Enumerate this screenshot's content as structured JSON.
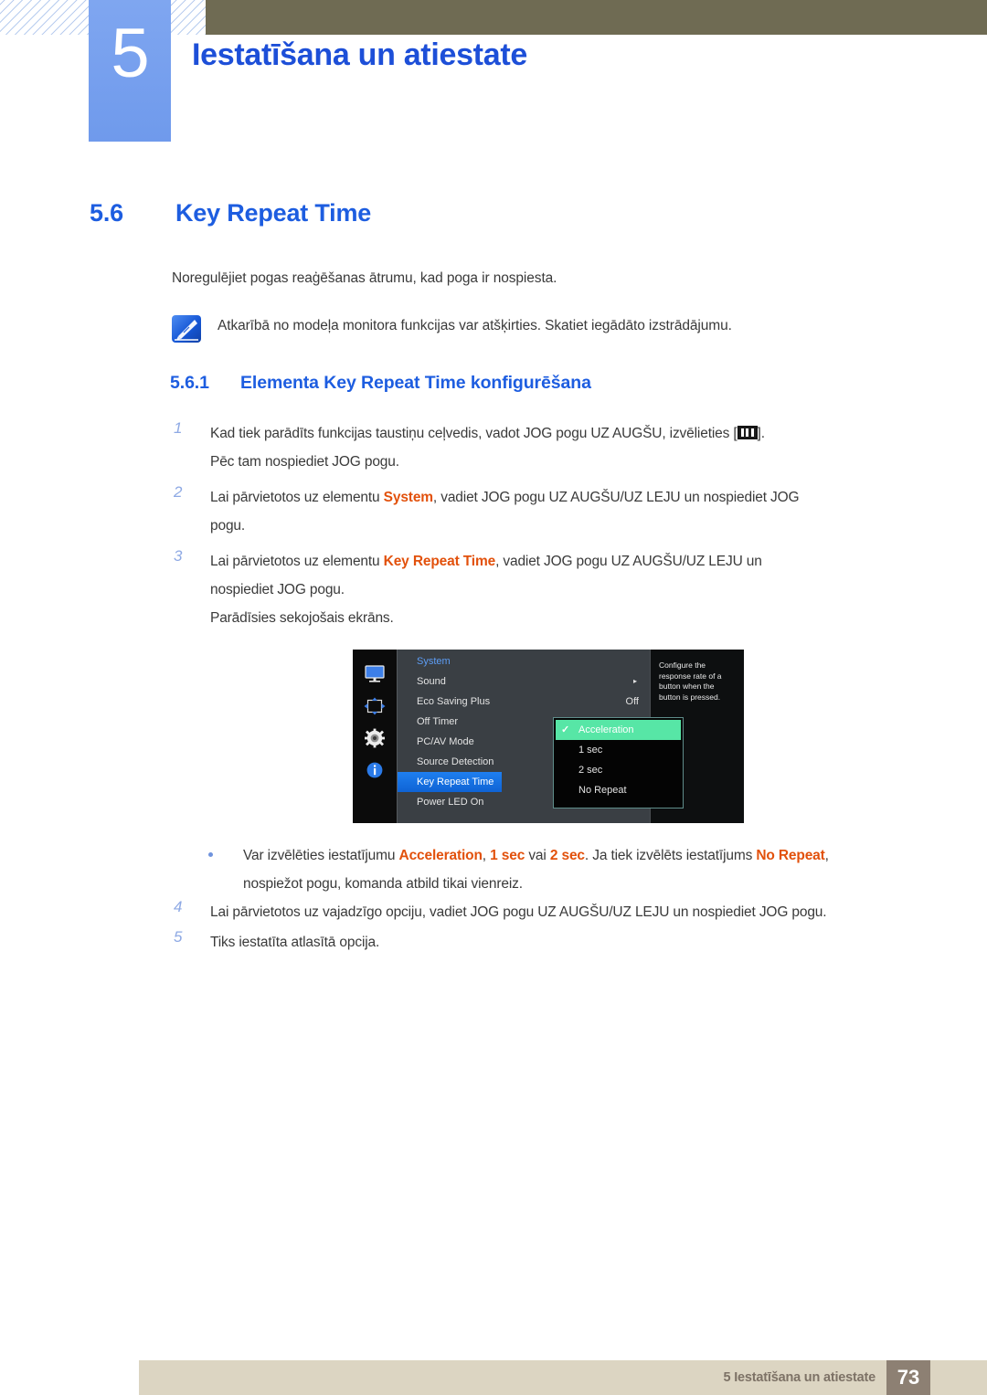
{
  "header": {
    "chapter_number": "5",
    "chapter_title": "Iestatīšana un atiestate",
    "hatch_color": "#b9cdef",
    "bar_color": "#6f6b53",
    "chapter_block_color": "#7fa6f0",
    "title_color": "#1d4fd8"
  },
  "section": {
    "number": "5.6",
    "title": "Key Repeat Time",
    "intro": "Noregulējiet pogas reaģēšanas ātrumu, kad poga ir nospiesta.",
    "color": "#1d5de0"
  },
  "note": {
    "icon": "note-pen-icon",
    "text": "Atkarībā no modeļa monitora funkcijas var atšķirties. Skatiet iegādāto izstrādājumu."
  },
  "subsection": {
    "number": "5.6.1",
    "title": "Elementa Key Repeat Time konfigurēšana"
  },
  "steps": [
    {
      "index": "1",
      "lines": [
        {
          "pre": "Kad tiek parādīts funkcijas taustiņu ceļvedis, vadot JOG pogu UZ AUGŠU, izvēlieties [",
          "icon": "menu-bars-icon",
          "post": "]."
        },
        {
          "pre": "Pēc tam nospiediet JOG pogu."
        }
      ]
    },
    {
      "index": "2",
      "lines": [
        {
          "pre": "Lai pārvietotos uz elementu ",
          "kw": "System",
          "post": ", vadiet JOG pogu UZ AUGŠU/UZ LEJU un nospiediet JOG"
        },
        {
          "pre": "pogu."
        }
      ]
    },
    {
      "index": "3",
      "lines": [
        {
          "pre": "Lai pārvietotos uz elementu ",
          "kw": "Key Repeat Time",
          "post": ", vadiet JOG pogu UZ AUGŠU/UZ LEJU un"
        },
        {
          "pre": "nospiediet JOG pogu."
        },
        {
          "pre": "Parādīsies sekojošais ekrāns."
        }
      ]
    }
  ],
  "osd": {
    "rail_icons": [
      "monitor-icon",
      "move-arrows-icon",
      "gear-icon",
      "info-icon"
    ],
    "menu_title": "System",
    "items": [
      {
        "label": "Sound",
        "value": "",
        "arrow": "▸",
        "selected": false
      },
      {
        "label": "Eco Saving Plus",
        "value": "Off",
        "arrow": "",
        "selected": false
      },
      {
        "label": "Off Timer",
        "value": "",
        "arrow": "",
        "selected": false
      },
      {
        "label": "PC/AV Mode",
        "value": "",
        "arrow": "",
        "selected": false
      },
      {
        "label": "Source Detection",
        "value": "",
        "arrow": "",
        "selected": false
      },
      {
        "label": "Key Repeat Time",
        "value": "",
        "arrow": "",
        "selected": true
      },
      {
        "label": "Power LED On",
        "value": "",
        "arrow": "",
        "selected": false
      }
    ],
    "submenu": [
      {
        "label": "Acceleration",
        "checked": true
      },
      {
        "label": "1 sec",
        "checked": false
      },
      {
        "label": "2 sec",
        "checked": false
      },
      {
        "label": "No Repeat",
        "checked": false
      }
    ],
    "description": "Configure the response rate of a button when the button is pressed.",
    "highlight_color": "#1e7ff0",
    "submenu_highlight_color": "#57e6a6",
    "title_color": "#5d9df5"
  },
  "bullet": {
    "line1_pre": "Var izvēlēties iestatījumu ",
    "kw1": "Acceleration",
    "line1_mid1": ", ",
    "kw2": "1 sec",
    "line1_mid2": " vai ",
    "kw3": "2 sec",
    "line1_mid3": ". Ja tiek izvēlēts iestatījums ",
    "kw4": "No Repeat",
    "line1_post": ",",
    "line2": "nospiežot pogu, komanda atbild tikai vienreiz."
  },
  "steps2": [
    {
      "index": "4",
      "lines": [
        {
          "pre": "Lai pārvietotos uz vajadzīgo opciju, vadiet JOG pogu UZ AUGŠU/UZ LEJU un nospiediet JOG pogu."
        }
      ]
    },
    {
      "index": "5",
      "lines": [
        {
          "pre": "Tiks iestatīta atlasītā opcija."
        }
      ]
    }
  ],
  "footer": {
    "text": "5 Iestatīšana un atiestate",
    "page": "73",
    "bar_color": "#dcd5c2",
    "page_box_color": "#8d8073"
  }
}
